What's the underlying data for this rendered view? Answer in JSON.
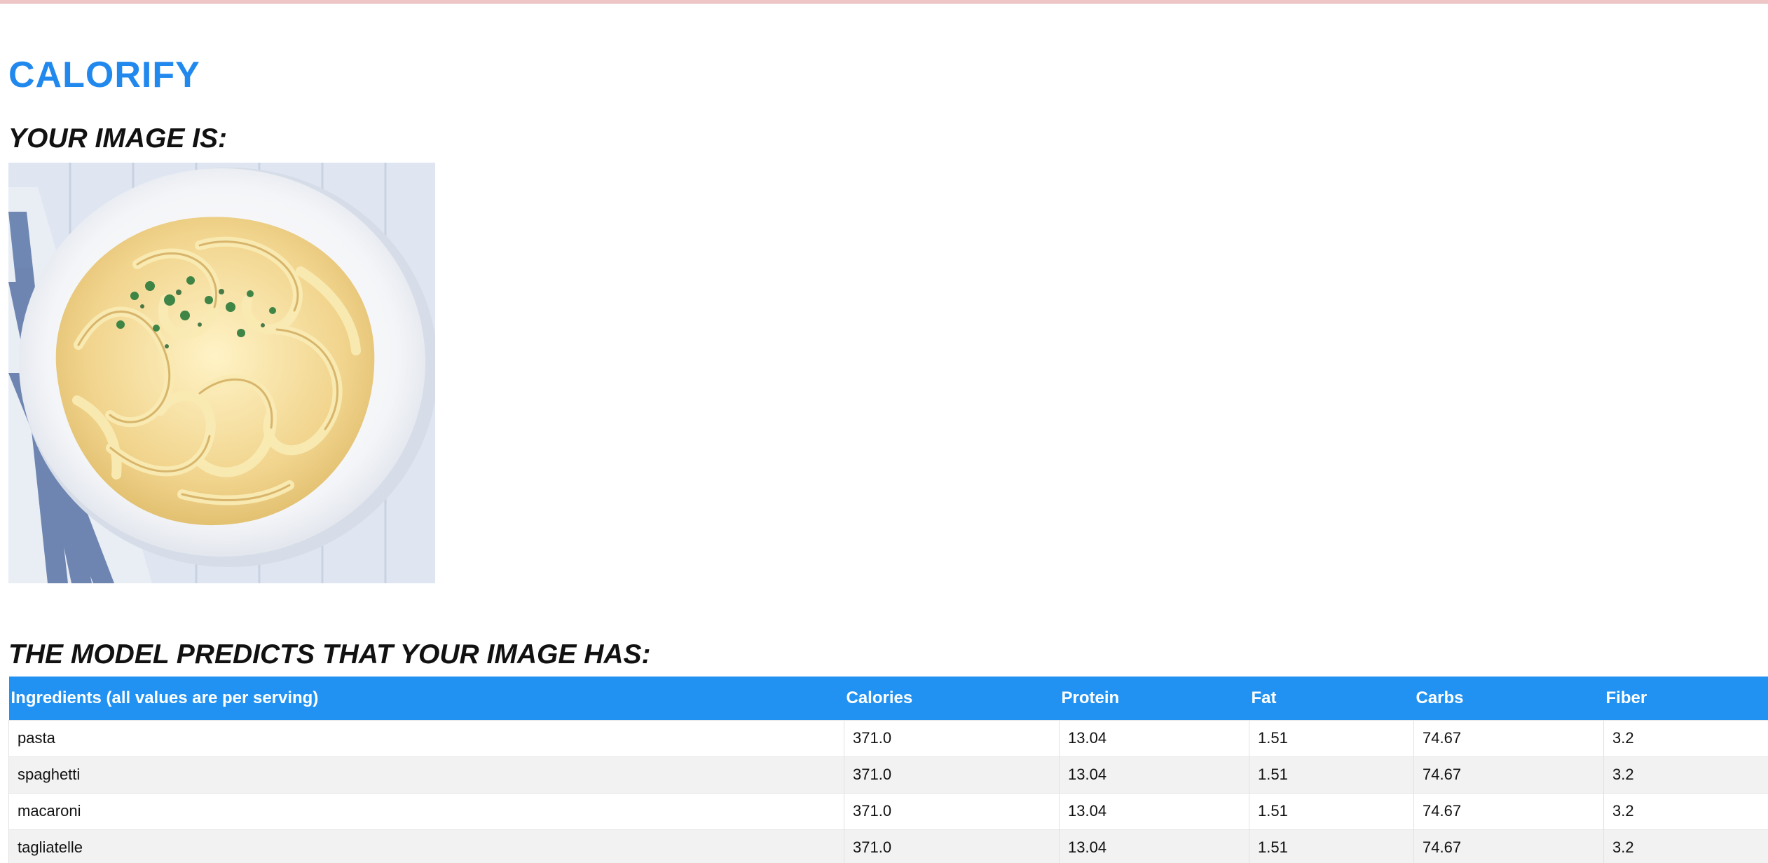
{
  "app": {
    "title": "CALORIFY"
  },
  "sections": {
    "image_heading": "YOUR IMAGE IS:",
    "prediction_heading": "THE MODEL PREDICTS THAT YOUR IMAGE HAS:"
  },
  "image": {
    "subject": "plate of fettuccine alfredo pasta",
    "icon": "food-photo"
  },
  "table": {
    "headers": [
      "Ingredients (all values are per serving)",
      "Calories",
      "Protein",
      "Fat",
      "Carbs",
      "Fiber"
    ],
    "rows": [
      [
        "pasta",
        "371.0",
        "13.04",
        "1.51",
        "74.67",
        "3.2"
      ],
      [
        "spaghetti",
        "371.0",
        "13.04",
        "1.51",
        "74.67",
        "3.2"
      ],
      [
        "macaroni",
        "371.0",
        "13.04",
        "1.51",
        "74.67",
        "3.2"
      ],
      [
        "tagliatelle",
        "371.0",
        "13.04",
        "1.51",
        "74.67",
        "3.2"
      ]
    ]
  },
  "colors": {
    "brand": "#2189ee",
    "table_header": "#2192f2",
    "row_alt": "#f2f2f2"
  }
}
